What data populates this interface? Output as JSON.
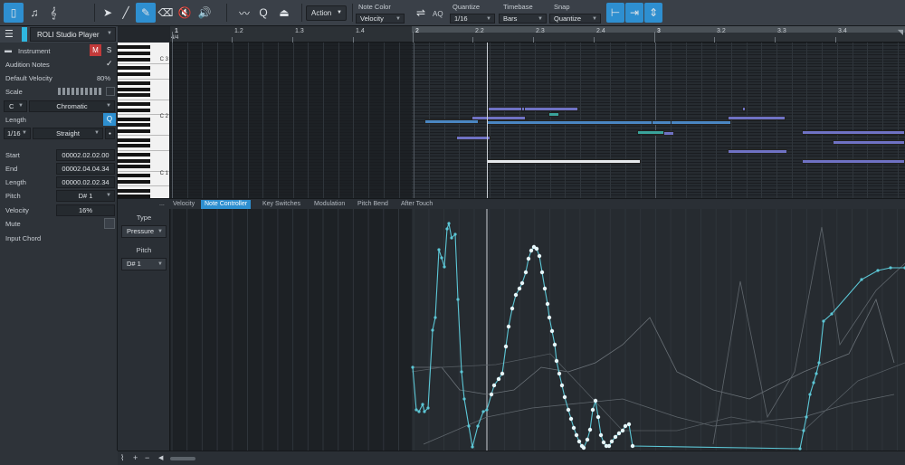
{
  "toolbar": {
    "action_label": "Action",
    "note_color_label": "Note Color",
    "note_color_value": "Velocity",
    "aq_label": "AQ",
    "quantize_label": "Quantize",
    "quantize_value": "1/16",
    "timebase_label": "Timebase",
    "timebase_value": "Bars",
    "snap_label": "Snap",
    "snap_value": "Quantize"
  },
  "inspector": {
    "instrument_name": "ROLI Studio Player",
    "instrument_label": "Instrument",
    "mute_btn": "M",
    "solo_btn": "S",
    "audition_notes_label": "Audition Notes",
    "audition_notes_check": "✓",
    "default_velocity_label": "Default Velocity",
    "default_velocity_value": "80%",
    "scale_label": "Scale",
    "scale_root": "C",
    "scale_type": "Chromatic",
    "length_label": "Length",
    "length_q": "Q",
    "length_value": "1/16",
    "length_mode": "Straight",
    "length_dot": "•",
    "start_label": "Start",
    "start_value": "00002.02.02.00",
    "end_label": "End",
    "end_value": "00002.04.04.34",
    "note_length_label": "Length",
    "note_length_value": "00000.02.02.34",
    "pitch_label": "Pitch",
    "pitch_value": "D# 1",
    "velocity_label": "Velocity",
    "velocity_value": "16%",
    "mute_label": "Mute",
    "input_chord_label": "Input Chord"
  },
  "piano": {
    "octave_labels": [
      "C 3",
      "C 2",
      "C 1"
    ]
  },
  "ruler": {
    "time_signature": "4/4",
    "labels": [
      "1",
      "1.2",
      "1.3",
      "1.4",
      "2",
      "2.2",
      "2.3",
      "2.4",
      "3",
      "3.2",
      "3.3",
      "3.4"
    ]
  },
  "lane_tabs": {
    "more": "...",
    "tabs": [
      "Velocity",
      "Note Controller",
      "Key Switches",
      "Modulation",
      "Pitch Bend",
      "After Touch"
    ],
    "active_index": 1
  },
  "lane_panel": {
    "type_label": "Type",
    "type_value": "Pressure",
    "pitch_label": "Pitch",
    "pitch_value": "D# 1"
  },
  "colors": {
    "accent": "#2e8fd0",
    "note_purple": "#6f72c4",
    "note_teal": "#3aa39b",
    "note_blue": "#4a86c2",
    "note_selected": "#e6e9ec",
    "controller_line": "#5cc7d6"
  }
}
